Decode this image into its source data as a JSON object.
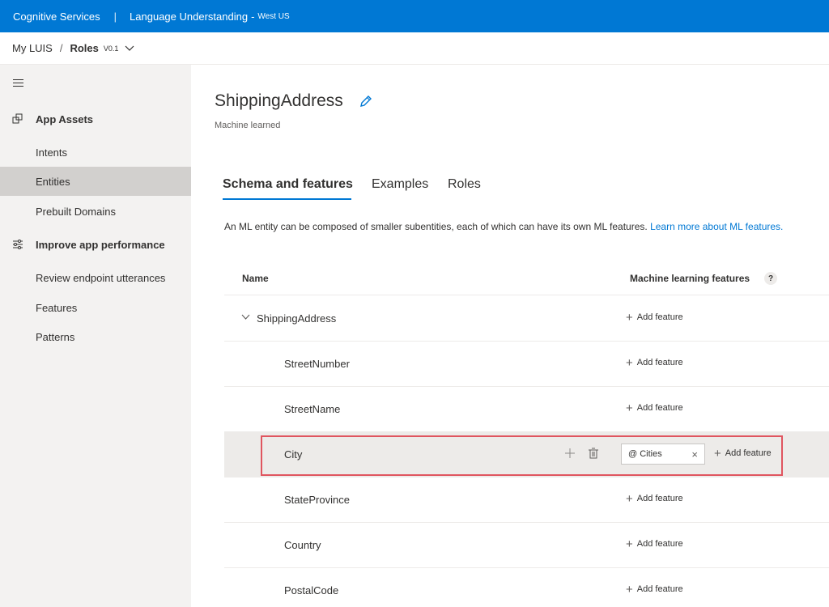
{
  "topbar": {
    "service": "Cognitive Services",
    "separator": "|",
    "product": "Language Understanding",
    "dash": "-",
    "region": "West US"
  },
  "breadcrumb": {
    "root": "My LUIS",
    "slash": "/",
    "app": "Roles",
    "version": "V0.1"
  },
  "sidebar": {
    "app_assets": "App Assets",
    "items_assets": [
      "Intents",
      "Entities",
      "Prebuilt Domains"
    ],
    "improve": "Improve app performance",
    "items_improve": [
      "Review endpoint utterances",
      "Features",
      "Patterns"
    ],
    "active_item": "Entities"
  },
  "entity": {
    "title": "ShippingAddress",
    "subtitle": "Machine learned"
  },
  "tabs": [
    "Schema and features",
    "Examples",
    "Roles"
  ],
  "description": {
    "text": "An ML entity can be composed of smaller subentities, each of which can have its own ML features.",
    "link": "Learn more about ML features."
  },
  "table": {
    "col_name": "Name",
    "col_features": "Machine learning features",
    "help": "?",
    "rows": [
      {
        "name": "ShippingAddress",
        "add": "Add feature"
      },
      {
        "name": "StreetNumber",
        "add": "Add feature"
      },
      {
        "name": "StreetName",
        "add": "Add feature"
      },
      {
        "name": "City",
        "chip": "Cities",
        "chip_prefix": "@",
        "add": "Add feature"
      },
      {
        "name": "StateProvince",
        "add": "Add feature"
      },
      {
        "name": "Country",
        "add": "Add feature"
      },
      {
        "name": "PostalCode",
        "add": "Add feature"
      }
    ]
  },
  "colors": {
    "brand": "#0078d4",
    "highlight_border": "#e0555f",
    "sidebar_bg": "#f3f2f1",
    "active_bg": "#d2d0ce"
  },
  "icons": [
    "hamburger-icon",
    "app-assets-icon",
    "improve-icon",
    "edit-icon",
    "chevron-down-icon",
    "add-icon",
    "delete-icon",
    "close-icon",
    "help-icon"
  ]
}
